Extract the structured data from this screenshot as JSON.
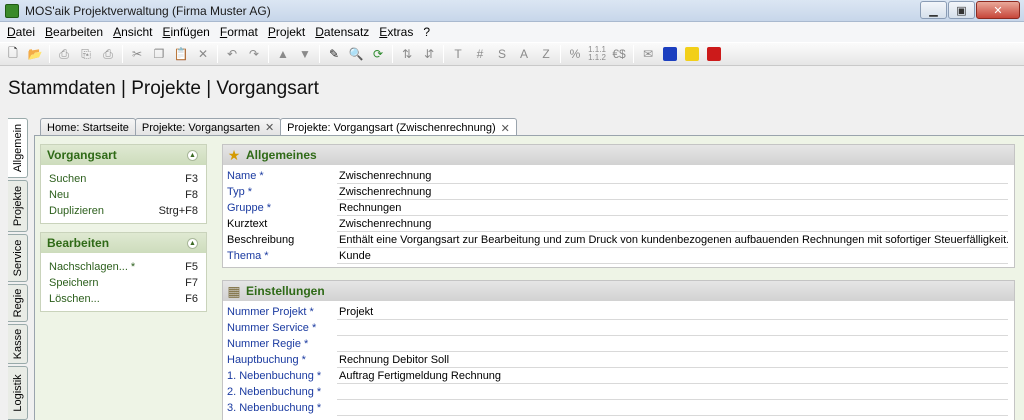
{
  "window": {
    "title": "MOS'aik Projektverwaltung (Firma Muster AG)"
  },
  "menu": [
    "Datei",
    "Bearbeiten",
    "Ansicht",
    "Einfügen",
    "Format",
    "Projekt",
    "Datensatz",
    "Extras",
    "?"
  ],
  "page_title": "Stammdaten | Projekte | Vorgangsart",
  "vertical_tabs": [
    "Allgemein",
    "Projekte",
    "Service",
    "Regie",
    "Kasse",
    "Logistik"
  ],
  "doc_tabs": [
    {
      "label": "Home: Startseite"
    },
    {
      "label": "Projekte: Vorgangsarten",
      "close": "✕"
    },
    {
      "label": "Projekte: Vorgangsart (Zwischenrechnung)",
      "close": "✕"
    }
  ],
  "panels": {
    "vorgangsart": {
      "title": "Vorgangsart",
      "items": [
        {
          "label": "Suchen",
          "key": "F3"
        },
        {
          "label": "Neu",
          "key": "F8"
        },
        {
          "label": "Duplizieren",
          "key": "Strg+F8"
        }
      ]
    },
    "bearbeiten": {
      "title": "Bearbeiten",
      "items": [
        {
          "label": "Nachschlagen... *",
          "key": "F5"
        },
        {
          "label": "Speichern",
          "key": "F7"
        },
        {
          "label": "Löschen...",
          "key": "F6"
        }
      ]
    }
  },
  "allgemeines": {
    "title": "Allgemeines",
    "rows": [
      {
        "label": "Name *",
        "value": "Zwischenrechnung",
        "required": true
      },
      {
        "label": "Typ *",
        "value": "Zwischenrechnung",
        "required": true
      },
      {
        "label": "Gruppe *",
        "value": "Rechnungen",
        "required": true
      },
      {
        "label": "Kurztext",
        "value": "Zwischenrechnung",
        "required": false
      },
      {
        "label": "Beschreibung",
        "value": "Enthält eine Vorgangsart zur Bearbeitung und zum Druck von kundenbezogenen aufbauenden Rechnungen mit sofortiger Steuerfälligkeit.",
        "required": false
      },
      {
        "label": "Thema *",
        "value": "Kunde",
        "required": true
      }
    ]
  },
  "einstellungen": {
    "title": "Einstellungen",
    "rows": [
      {
        "label": "Nummer Projekt *",
        "value": "Projekt"
      },
      {
        "label": "Nummer Service *",
        "value": ""
      },
      {
        "label": "Nummer Regie *",
        "value": ""
      },
      {
        "label": "Hauptbuchung *",
        "value": "Rechnung Debitor Soll"
      },
      {
        "label": "1. Nebenbuchung *",
        "value": "Auftrag Fertigmeldung Rechnung"
      },
      {
        "label": "2. Nebenbuchung *",
        "value": ""
      },
      {
        "label": "3. Nebenbuchung *",
        "value": ""
      }
    ]
  },
  "colors": {
    "accent_green": "#2f6a17",
    "required_blue": "#1a3aa0"
  }
}
